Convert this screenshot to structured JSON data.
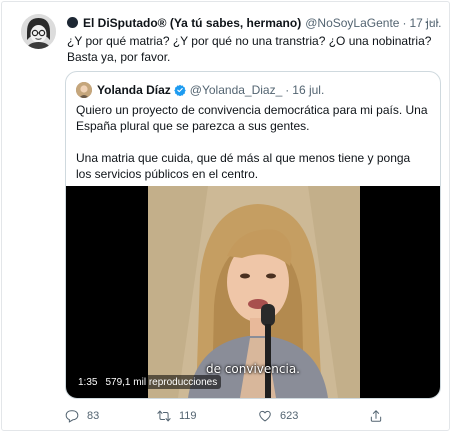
{
  "tweet": {
    "author_name": "El DiSputado® (Ya tú sabes, hermano)",
    "author_handle": "@NoSoyLaGente",
    "date": "17 jul.",
    "text": "¿Y por qué matria? ¿Y por qué no una transtria? ¿O una nobinatria? Basta ya, por favor.",
    "more_icon": "more-horizontal-icon"
  },
  "quoted": {
    "author_name": "Yolanda Díaz",
    "author_handle": "@Yolanda_Diaz_",
    "date": "16 jul.",
    "paragraph_1": "Quiero un proyecto de convivencia democrática para mi país. Una España plural que se parezca a sus gentes.",
    "paragraph_2": "Una matria que cuida, que dé más al que menos tiene y ponga los servicios públicos en el centro.",
    "verified_color": "#1d9bf0"
  },
  "video": {
    "caption": "de convivencia.",
    "duration": "1:35",
    "views": "579,1 mil reproducciones"
  },
  "actions": {
    "replies": "83",
    "retweets": "119",
    "likes": "623"
  }
}
